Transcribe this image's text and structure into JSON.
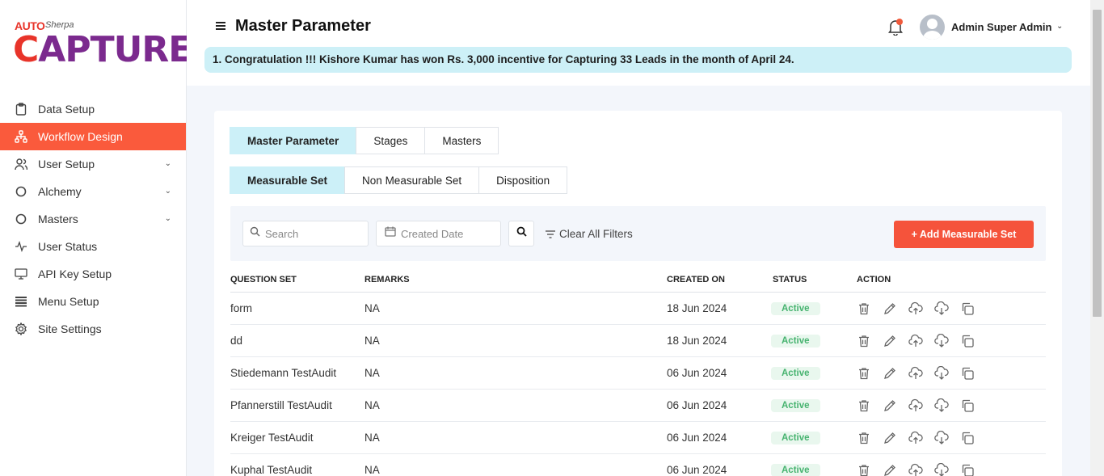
{
  "brand": {
    "auto": "AUTO",
    "sherpa": "Sherpa",
    "capture_c": "C",
    "capture_rest": "APTURE"
  },
  "sidebar": {
    "items": [
      {
        "label": "Data Setup",
        "icon": "clipboard-icon",
        "chevron": false,
        "active": false
      },
      {
        "label": "Workflow Design",
        "icon": "workflow-icon",
        "chevron": false,
        "active": true
      },
      {
        "label": "User Setup",
        "icon": "users-icon",
        "chevron": true,
        "active": false
      },
      {
        "label": "Alchemy",
        "icon": "circle-icon",
        "chevron": true,
        "active": false
      },
      {
        "label": "Masters",
        "icon": "circle-icon",
        "chevron": true,
        "active": false
      },
      {
        "label": "User Status",
        "icon": "activity-icon",
        "chevron": false,
        "active": false
      },
      {
        "label": "API Key Setup",
        "icon": "monitor-icon",
        "chevron": false,
        "active": false
      },
      {
        "label": "Menu Setup",
        "icon": "menu-list-icon",
        "chevron": false,
        "active": false
      },
      {
        "label": "Site Settings",
        "icon": "gear-icon",
        "chevron": false,
        "active": false
      }
    ]
  },
  "header": {
    "title": "Master Parameter",
    "user_name": "Admin Super Admin",
    "banner": "1. Congratulation !!! Kishore Kumar has won Rs. 3,000 incentive for Capturing 33 Leads in the month of April 24."
  },
  "tabs": {
    "main": [
      "Master Parameter",
      "Stages",
      "Masters"
    ],
    "sub": [
      "Measurable Set",
      "Non Measurable Set",
      "Disposition"
    ]
  },
  "filters": {
    "search_placeholder": "Search",
    "date_placeholder": "Created Date",
    "clear_label": "Clear All Filters",
    "add_label": "+ Add Measurable Set"
  },
  "table": {
    "headers": {
      "question_set": "QUESTION SET",
      "remarks": "REMARKS",
      "created_on": "CREATED ON",
      "status": "STATUS",
      "action": "ACTION"
    },
    "rows": [
      {
        "question_set": "form",
        "remarks": "NA",
        "created_on": "18 Jun 2024",
        "status": "Active"
      },
      {
        "question_set": "dd",
        "remarks": "NA",
        "created_on": "18 Jun 2024",
        "status": "Active"
      },
      {
        "question_set": "Stiedemann TestAudit",
        "remarks": "NA",
        "created_on": "06 Jun 2024",
        "status": "Active"
      },
      {
        "question_set": "Pfannerstill TestAudit",
        "remarks": "NA",
        "created_on": "06 Jun 2024",
        "status": "Active"
      },
      {
        "question_set": "Kreiger TestAudit",
        "remarks": "NA",
        "created_on": "06 Jun 2024",
        "status": "Active"
      },
      {
        "question_set": "Kuphal TestAudit",
        "remarks": "NA",
        "created_on": "06 Jun 2024",
        "status": "Active"
      }
    ]
  },
  "colors": {
    "accent": "#f5533b",
    "active_tab": "#ccf0f8",
    "banner": "#cdf0f7",
    "status_green": "#46b36f"
  }
}
